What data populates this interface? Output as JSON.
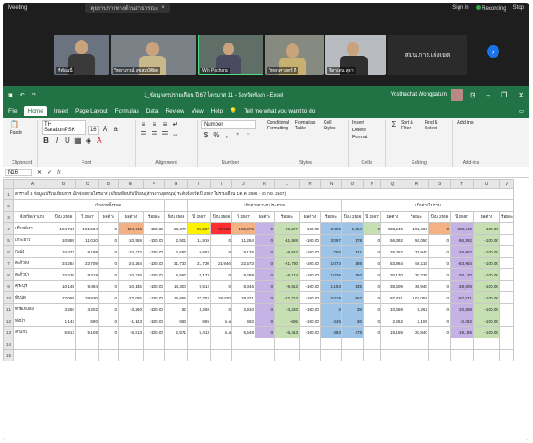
{
  "meeting": {
    "app_label": "Meeting",
    "tab_label": "คุยงานการทางด้านสาธารณะ",
    "sign_in": "Sign in",
    "recording": "Recording",
    "stop": "Stop",
    "tiles": [
      {
        "name": "ทีฟ่อนนี่"
      },
      {
        "name": "วิทยาภรณ์ สุขสมบัติจิต"
      },
      {
        "name": "Win Pachara"
      },
      {
        "name": "วิทยาศาสตร์ ดี"
      },
      {
        "name": "จิดาเด่น สุธา"
      }
    ],
    "presenter": "สมน.กาง.เก่งเขต"
  },
  "excel": {
    "title": "1_ข้อมูลสรุปรายเดือน ปี 67 ไตรมาส 11 - จังหวัดพังงา - Excel",
    "user": "Yosthachat Wongpatum",
    "quick_access": [
      "save",
      "undo",
      "redo"
    ],
    "menu": [
      "File",
      "Home",
      "Insert",
      "Page Layout",
      "Formulas",
      "Data",
      "Review",
      "View",
      "Help"
    ],
    "tell_me": "Tell me what you want to do",
    "ribbon": {
      "paste": "Paste",
      "font_name": "TH SarabunPSK",
      "font_size": "16",
      "number_format": "Number",
      "clipboard": "Clipboard",
      "font": "Font",
      "alignment": "Alignment",
      "number": "Number",
      "styles": "Styles",
      "cells": "Cells",
      "editing": "Editing",
      "addins": "Add-ins",
      "conditional": "Conditional Formatting",
      "format_table": "Format as Table",
      "cell_styles": "Cell Styles",
      "insert": "Insert",
      "delete": "Delete",
      "format": "Format",
      "sort": "Sort & Filter",
      "find": "Find & Select",
      "addins_btn": "Add-ins"
    },
    "namebox": "N16",
    "fx": "fx"
  },
  "sheet": {
    "col_letters": [
      "A",
      "B",
      "C",
      "D",
      "E",
      "F",
      "G",
      "H",
      "I",
      "J",
      "K",
      "L",
      "M",
      "N",
      "O",
      "P",
      "Q",
      "R",
      "S",
      "T",
      "U",
      "V"
    ],
    "title_row": "ตารางที่ 1 ข้อมูลเปรียบเทียบการ เบิกจ่ายตามไตรมาส เปรียบเทียบกับปีก่อน (ส่วนงานอุดหนุน) ระดับจังหวัด ปี 2567 ไม่รวมเดือน 1 ต.ค. 2566 - 30 ก.ย. 2567)",
    "group_headers": [
      "เบิกจ่ายทั้งหมด",
      "เบิกจ่ายจากงบประมาณ",
      "เบิกจ่ายไม่รวม"
    ],
    "sub_headers": [
      "จังหวัด/อำเภอ",
      "ผลต่าง",
      "ร้อยละ",
      "ปีงบ 2566",
      "ปี 2567",
      "ผลต่าง",
      "ร้อยละ",
      "ปีงบ 2566",
      "ปี 2567",
      "ผลต่าง",
      "ร้อยละ"
    ],
    "rows": [
      {
        "n": "4",
        "name": "เมืองพังงา",
        "v": [
          "104,716",
          "101,564",
          "0",
          "-104,716",
          "-100.00",
          "33,677",
          "89,227",
          "55,633",
          "165,675",
          "0",
          "-89,227",
          "-100.00",
          "3,409",
          "1,654",
          "0",
          "333,249",
          "192,468",
          "0",
          "-338,249",
          "-100.00"
        ]
      },
      {
        "n": "5",
        "name": "เกาะยาว",
        "v": [
          "10,959",
          "11,010",
          "0",
          "-10,959",
          "-100.00",
          "2,501",
          "11,919",
          "0",
          "11,254",
          "0",
          "-11,919",
          "-100.00",
          "3,097",
          "178",
          "0",
          "56,392",
          "50,050",
          "0",
          "-56,392",
          "-100.00"
        ]
      },
      {
        "n": "6",
        "name": "กะปง",
        "v": [
          "10,472",
          "9,199",
          "0",
          "-10,472",
          "-100.00",
          "2,697",
          "9,682",
          "0",
          "9,125",
          "0",
          "-9,682",
          "-100.00",
          "750",
          "121",
          "0",
          "26,052",
          "31,940",
          "0",
          "-26,052",
          "-100.00"
        ]
      },
      {
        "n": "7",
        "name": "ตะกั่วทุ่ง",
        "v": [
          "24,264",
          "23,709",
          "0",
          "-24,264",
          "-100.00",
          "21,730",
          "21,730",
          "21,946",
          "22,573",
          "0",
          "-21,730",
          "-100.00",
          "1,074",
          "198",
          "0",
          "83,984",
          "56,115",
          "0",
          "-83,984",
          "-100.00"
        ]
      },
      {
        "n": "8",
        "name": "ตะกั่วป่า",
        "v": [
          "10,226",
          "9,319",
          "0",
          "-10,226",
          "-100.00",
          "6,667",
          "8,174",
          "0",
          "9,289",
          "0",
          "-8,174",
          "-100.00",
          "1,036",
          "150",
          "0",
          "30,170",
          "30,235",
          "0",
          "-30,170",
          "-100.00"
        ]
      },
      {
        "n": "9",
        "name": "คุระบุรี",
        "v": [
          "10,145",
          "9,494",
          "0",
          "-10,145",
          "-100.00",
          "14,300",
          "9,512",
          "0",
          "8,346",
          "0",
          "-9,512",
          "-100.00",
          "1,183",
          "135",
          "0",
          "38,609",
          "36,940",
          "0",
          "-38,609",
          "-100.00"
        ]
      },
      {
        "n": "10",
        "name": "ทับปุด",
        "v": [
          "27,065",
          "28,830",
          "0",
          "-27,065",
          "-100.00",
          "26,665",
          "27,753",
          "28,470",
          "28,371",
          "0",
          "-27,753",
          "-100.00",
          "3,419",
          "867",
          "0",
          "97,821",
          "103,059",
          "0",
          "-97,821",
          "-100.00"
        ]
      },
      {
        "n": "11",
        "name": "ท้ายเหมือง",
        "v": [
          "3,260",
          "3,202",
          "0",
          "-3,260",
          "-100.00",
          "52",
          "3,260",
          "0",
          "2,910",
          "0",
          "-3,260",
          "-100.00",
          "0",
          "38",
          "0",
          "10,659",
          "9,262",
          "0",
          "-10,659",
          "-100.00"
        ]
      },
      {
        "n": "12",
        "name": "ท่อป่า",
        "v": [
          "1,143",
          "590",
          "0",
          "-1,143",
          "-100.00",
          "660",
          "695",
          "n.a",
          "592",
          "0",
          "-695",
          "-100.00",
          "445",
          "36",
          "0",
          "2,262",
          "2,106",
          "0",
          "-2,262",
          "-100.00"
        ]
      },
      {
        "n": "13",
        "name": "ลำแก่น",
        "v": [
          "5,813",
          "5,106",
          "0",
          "-5,813",
          "-100.00",
          "2,571",
          "5,413",
          "n.a",
          "5,548",
          "0",
          "-5,413",
          "-100.00",
          "483",
          "478",
          "0",
          "19,159",
          "20,840",
          "0",
          "-19,159",
          "-100.00"
        ]
      }
    ]
  }
}
